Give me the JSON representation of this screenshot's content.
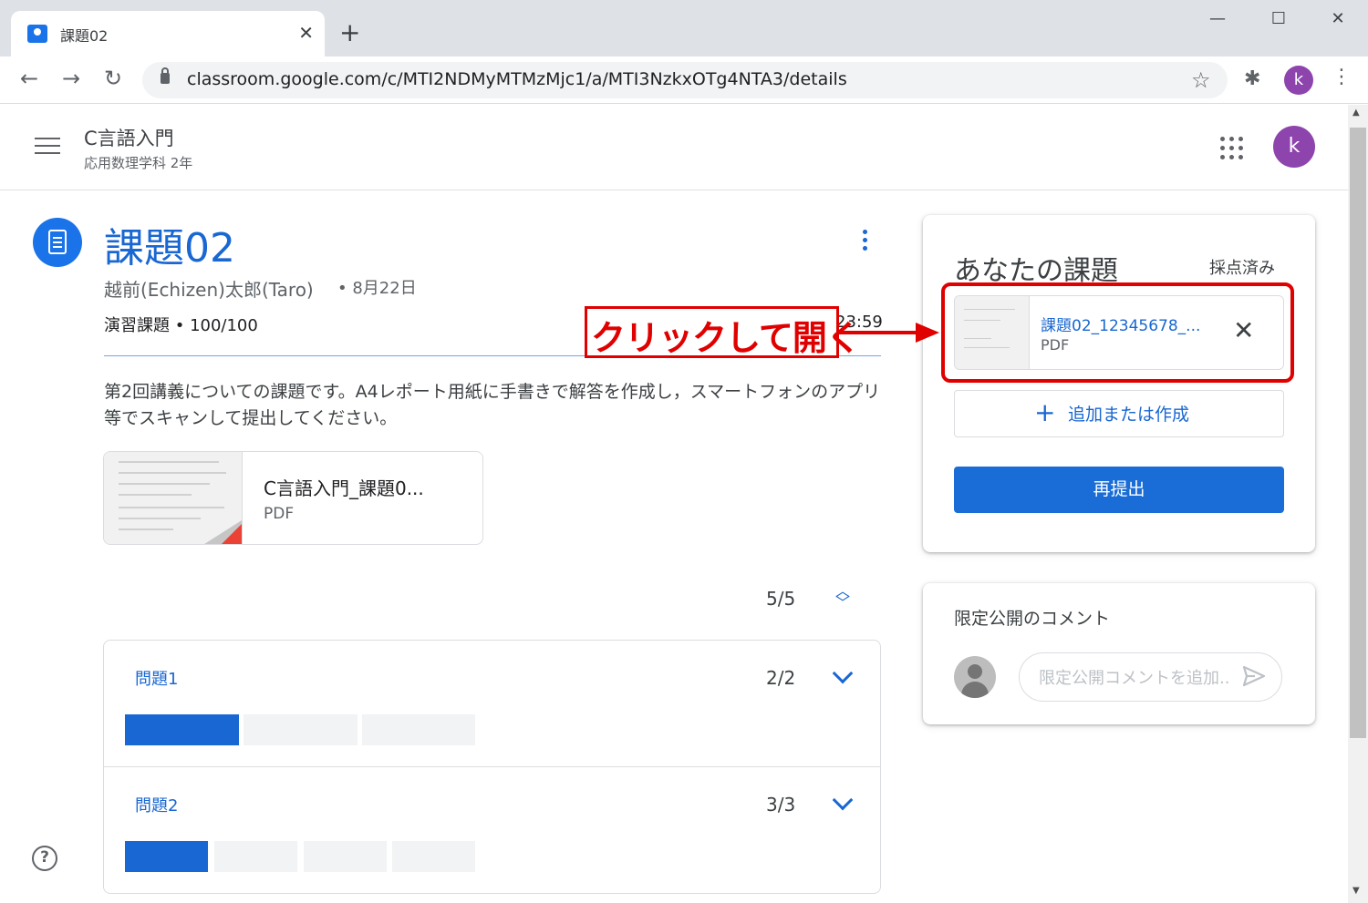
{
  "browser": {
    "tab_title": "課題02",
    "tab_close": "✕",
    "new_tab": "+",
    "url": "classroom.google.com/c/MTI2NDMyMTMzMjc1/a/MTI3NzkxOTg4NTA3/details",
    "profile_initial": "k",
    "window_controls": [
      "—",
      "☐",
      "✕"
    ]
  },
  "header": {
    "class_name": "C言語入門",
    "class_section": "応用数理学科 2年",
    "avatar_initial": "k"
  },
  "assignment": {
    "title": "課題02",
    "author": "越前(Echizen)太郎(Taro)",
    "date": "• 8月22日",
    "points_label": "演習課題 • ",
    "points_value": "100/100",
    "due": "23:59",
    "description": "第2回講義についての課題です。A4レポート用紙に手書きで解答を作成し，スマートフォンのアプリ等でスキャンして提出してください。",
    "attachment": {
      "name": "C言語入門_課題0...",
      "type": "PDF"
    }
  },
  "progress": {
    "count": "5/5",
    "questions": [
      {
        "title": "問題1",
        "score": "2/2",
        "completed": 1,
        "total": 3
      },
      {
        "title": "問題2",
        "score": "3/3",
        "completed": 1,
        "total": 4
      }
    ]
  },
  "your_work": {
    "title": "あなたの課題",
    "status": "採点済み",
    "file": {
      "name": "課題02_12345678_...",
      "type": "PDF"
    },
    "add_label": "追加または作成",
    "resubmit_label": "再提出"
  },
  "private_comments": {
    "title": "限定公開のコメント",
    "placeholder": "限定公開コメントを追加..."
  },
  "annotation": {
    "text": "クリックして開く",
    "color": "#e00000"
  },
  "colors": {
    "accent": "#1967d2",
    "primary_button": "#1a6dd6",
    "avatar": "#8e44ad"
  }
}
